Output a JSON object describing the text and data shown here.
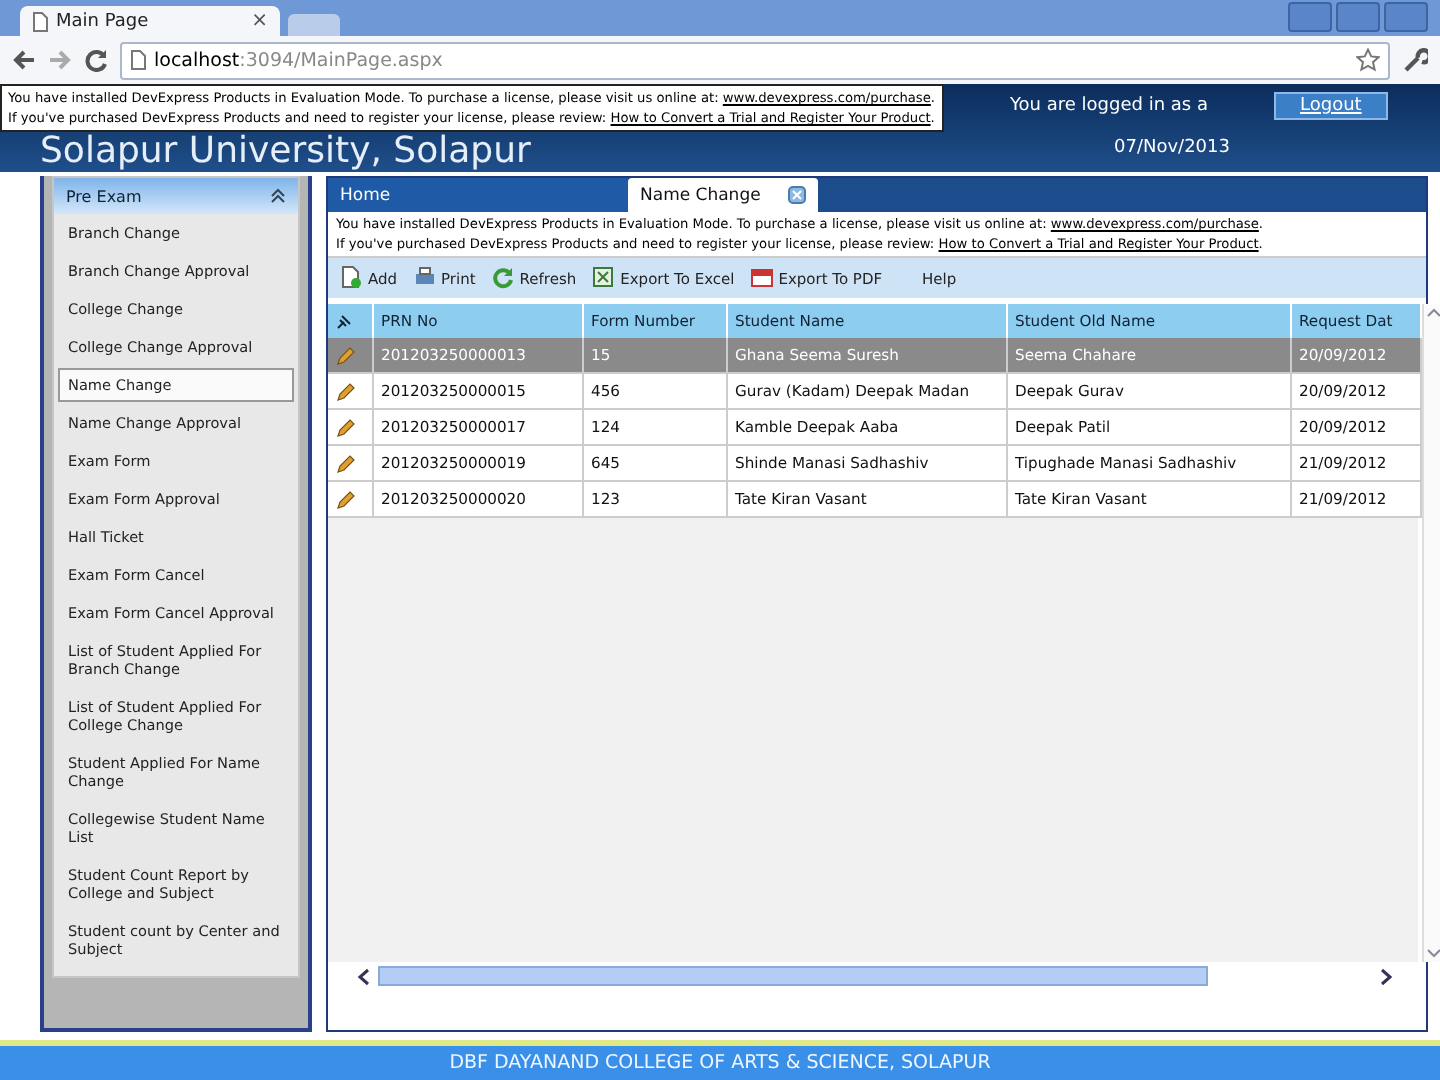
{
  "browser": {
    "tab_title": "Main Page",
    "tab_close": "×",
    "url_host": "localhost",
    "url_path": ":3094/MainPage.aspx"
  },
  "header": {
    "title": "Solapur University, Solapur",
    "login_text": "You are logged in as a",
    "logout": "Logout",
    "date": "07/Nov/2013"
  },
  "top_banner": [
    {
      "text": "You have installed DevExpress Products in Evaluation Mode. To purchase a license, please visit us online at: ",
      "link": "www.devexpress.com/purchase",
      "after": "."
    },
    {
      "text": "If you've purchased DevExpress Products and need to register your license, please review: ",
      "link": "How to Convert a Trial and Register Your Product",
      "after": "."
    }
  ],
  "sidebar": {
    "title": "Pre Exam",
    "items": [
      {
        "label": "Branch Change",
        "selected": false
      },
      {
        "label": "Branch Change Approval",
        "selected": false
      },
      {
        "label": "College Change",
        "selected": false
      },
      {
        "label": "College Change Approval",
        "selected": false
      },
      {
        "label": "Name Change",
        "selected": true
      },
      {
        "label": "Name Change Approval",
        "selected": false
      },
      {
        "label": "Exam Form",
        "selected": false
      },
      {
        "label": "Exam Form Approval",
        "selected": false
      },
      {
        "label": "Hall Ticket",
        "selected": false
      },
      {
        "label": "Exam Form Cancel",
        "selected": false
      },
      {
        "label": "Exam Form Cancel Approval",
        "selected": false
      },
      {
        "label": "List of Student Applied For Branch Change",
        "selected": false
      },
      {
        "label": "List of Student Applied For College Change",
        "selected": false
      },
      {
        "label": "Student Applied For Name Change",
        "selected": false
      },
      {
        "label": "Collegewise Student Name List",
        "selected": false
      },
      {
        "label": "Student Count Report by College and Subject",
        "selected": false
      },
      {
        "label": "Student count by Center and Subject",
        "selected": false
      }
    ]
  },
  "tabs": [
    {
      "label": "Home",
      "selected": false,
      "closable": false
    },
    {
      "label": "Name Change",
      "selected": true,
      "closable": true
    }
  ],
  "panel_banner": [
    {
      "text": "You have installed DevExpress Products in Evaluation Mode. To purchase a license, please visit us online at: ",
      "link": "www.devexpress.com/purchase",
      "after": "."
    },
    {
      "text": "If you've purchased DevExpress Products and need to register your license, please review: ",
      "link": "How to Convert a Trial and Register Your Product",
      "after": "."
    }
  ],
  "toolbar": [
    {
      "label": "Add",
      "kind": "add"
    },
    {
      "label": "Print",
      "kind": "print"
    },
    {
      "label": "Refresh",
      "kind": "refresh"
    },
    {
      "label": "Export To Excel",
      "kind": "excel"
    },
    {
      "label": "Export To PDF",
      "kind": "pdf"
    },
    {
      "label": "Help",
      "kind": "plain"
    }
  ],
  "grid": {
    "columns": [
      "PRN No",
      "Form Number",
      "Student Name",
      "Student Old Name",
      "Request Dat"
    ],
    "rows": [
      {
        "selected": true,
        "cells": [
          "201203250000013",
          "15",
          "Ghana Seema Suresh",
          "Seema Chahare",
          "20/09/2012"
        ]
      },
      {
        "selected": false,
        "cells": [
          "201203250000015",
          "456",
          "Gurav (Kadam) Deepak Madan",
          "Deepak Gurav",
          "20/09/2012"
        ]
      },
      {
        "selected": false,
        "cells": [
          "201203250000017",
          "124",
          "Kamble Deepak Aaba",
          "Deepak Patil",
          "20/09/2012"
        ]
      },
      {
        "selected": false,
        "cells": [
          "201203250000019",
          "645",
          "Shinde Manasi Sadhashiv",
          "Tipughade Manasi Sadhashiv",
          "21/09/2012"
        ]
      },
      {
        "selected": false,
        "cells": [
          "201203250000020",
          "123",
          "Tate Kiran Vasant",
          "Tate Kiran Vasant",
          "21/09/2012"
        ]
      }
    ]
  },
  "footer": "DBF DAYANAND COLLEGE OF ARTS & SCIENCE, SOLAPUR"
}
